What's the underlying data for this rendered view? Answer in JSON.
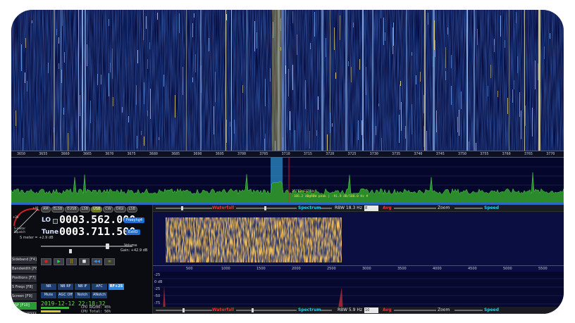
{
  "main_axis": {
    "ticks": [
      "3650",
      "3655",
      "3660",
      "3665",
      "3670",
      "3675",
      "3680",
      "3685",
      "3690",
      "3695",
      "3700",
      "3705",
      "3710",
      "3715",
      "3720",
      "3725",
      "3730",
      "3735",
      "3740",
      "3745",
      "3750",
      "3755",
      "3760",
      "3765",
      "3770"
    ]
  },
  "marker": {
    "line1": "3 713.637 Hz",
    "line2": "-106.2 dB@RBW peak | -91.9 dB/500.0 Hz #"
  },
  "smeter": {
    "scale_left": "+20",
    "scale_right": "+40",
    "reading": "S meter = +2.9 dB",
    "label1": "S-meter",
    "label2": "Squelch"
  },
  "modes": [
    "AM",
    "ELSB",
    "EUSB",
    "LSB",
    "USB",
    "CW",
    "DIGI",
    "LSB"
  ],
  "modes_on_index": 4,
  "lo": {
    "label": "LO",
    "value": "0003.562.000",
    "button": "Freeyhg4"
  },
  "tune": {
    "label": "Tune",
    "value": "0003.711.500",
    "button": "ExtIO"
  },
  "volume": {
    "label": "Volume",
    "gain": "Gain: +42.9 dB"
  },
  "side_buttons": [
    {
      "label": "Sideband  [F4]",
      "green": false
    },
    {
      "label": "Bandwidth [F6]",
      "green": false
    },
    {
      "label": "Positions [F7]",
      "green": false
    },
    {
      "label": "S Freqs   [F8]",
      "green": false
    },
    {
      "label": "Screen    [F9]",
      "green": false
    },
    {
      "label": "DSP      [F10]",
      "green": true
    },
    {
      "label": "Options  [F11]",
      "green": false
    }
  ],
  "transport": [
    "●",
    "▶",
    "||",
    "■",
    "◀◀",
    "∞"
  ],
  "dsp_row1": [
    {
      "label": "NR",
      "hi": false
    },
    {
      "label": "NB RF",
      "hi": false
    },
    {
      "label": "NB IF",
      "hi": false
    },
    {
      "label": "AFC",
      "hi": false
    },
    {
      "label": "RF+25",
      "hi": true
    }
  ],
  "dsp_row2": [
    {
      "label": "Mute",
      "hi": false
    },
    {
      "label": "AGC Off",
      "hi": false
    },
    {
      "label": "Notch",
      "hi": false
    },
    {
      "label": "ANotch",
      "hi": false
    }
  ],
  "clock": "2019-12-12 22:18:32",
  "cpu": {
    "line1": "CPU RX200: 45%",
    "line2": "CPU Total: 56%"
  },
  "bar1": {
    "waterfall": "Waterfall",
    "spectrum": "Spectrum",
    "rbw": "RBW 18.3 Hz",
    "avg_value": "8",
    "avg": "Avg",
    "zoom": "Zoom",
    "speed": "Speed"
  },
  "bar2": {
    "waterfall": "Waterfall",
    "spectrum": "Spectrum",
    "rbw": "RBW 5.9 Hz",
    "avg_value": "10",
    "avg": "Avg",
    "zoom": "Zoom",
    "speed": "Speed"
  },
  "zoom_axis": [
    "500",
    "1000",
    "1500",
    "2000",
    "2500",
    "3000",
    "3500",
    "4000",
    "4500",
    "5000",
    "5500"
  ],
  "zoom_db": [
    "-25",
    "0 dB",
    "-25",
    "-50",
    "-75",
    "-100"
  ],
  "colors": {
    "waterfall_bg": "#050a45",
    "spectrum_fill": "#2b8a2b",
    "accent_blue": "#1e6ed0",
    "passband": "#2b8ec8",
    "tune_line": "#e02020"
  }
}
